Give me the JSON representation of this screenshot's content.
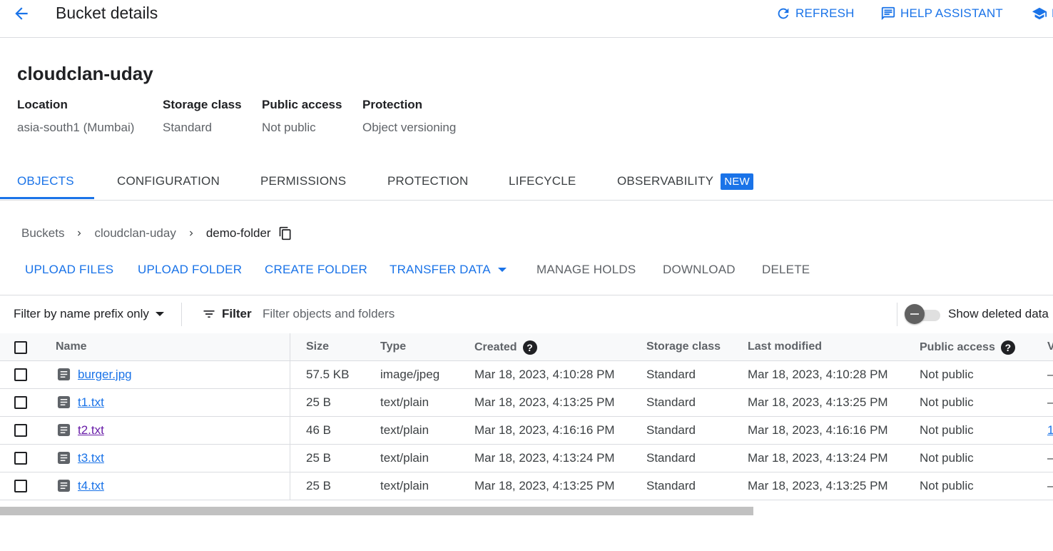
{
  "header": {
    "title": "Bucket details",
    "refresh_label": "REFRESH",
    "help_assistant_label": "HELP ASSISTANT",
    "learn_label": "L"
  },
  "bucket": {
    "name": "cloudclan-uday",
    "info": [
      {
        "label": "Location",
        "value": "asia-south1 (Mumbai)"
      },
      {
        "label": "Storage class",
        "value": "Standard"
      },
      {
        "label": "Public access",
        "value": "Not public"
      },
      {
        "label": "Protection",
        "value": "Object versioning"
      }
    ]
  },
  "tabs": [
    {
      "label": "OBJECTS",
      "active": true
    },
    {
      "label": "CONFIGURATION"
    },
    {
      "label": "PERMISSIONS"
    },
    {
      "label": "PROTECTION"
    },
    {
      "label": "LIFECYCLE"
    },
    {
      "label": "OBSERVABILITY",
      "badge": "NEW"
    }
  ],
  "breadcrumb": [
    "Buckets",
    "cloudclan-uday",
    "demo-folder"
  ],
  "actions": {
    "upload_files": "UPLOAD FILES",
    "upload_folder": "UPLOAD FOLDER",
    "create_folder": "CREATE FOLDER",
    "transfer_data": "TRANSFER DATA",
    "manage_holds": "MANAGE HOLDS",
    "download": "DOWNLOAD",
    "delete": "DELETE"
  },
  "filter": {
    "prefix_label": "Filter by name prefix only",
    "filter_label": "Filter",
    "placeholder": "Filter objects and folders",
    "show_deleted_label": "Show deleted data"
  },
  "table": {
    "columns": {
      "name": "Name",
      "size": "Size",
      "type": "Type",
      "created": "Created",
      "storage_class": "Storage class",
      "last_modified": "Last modified",
      "public_access": "Public access",
      "version": "V"
    },
    "rows": [
      {
        "name": "burger.jpg",
        "size": "57.5 KB",
        "type": "image/jpeg",
        "created": "Mar 18, 2023, 4:10:28 PM",
        "storage_class": "Standard",
        "last_modified": "Mar 18, 2023, 4:10:28 PM",
        "public_access": "Not public",
        "version": "–"
      },
      {
        "name": "t1.txt",
        "size": "25 B",
        "type": "text/plain",
        "created": "Mar 18, 2023, 4:13:25 PM",
        "storage_class": "Standard",
        "last_modified": "Mar 18, 2023, 4:13:25 PM",
        "public_access": "Not public",
        "version": "–"
      },
      {
        "name": "t2.txt",
        "size": "46 B",
        "type": "text/plain",
        "created": "Mar 18, 2023, 4:16:16 PM",
        "storage_class": "Standard",
        "last_modified": "Mar 18, 2023, 4:16:16 PM",
        "public_access": "Not public",
        "version": "1"
      },
      {
        "name": "t3.txt",
        "size": "25 B",
        "type": "text/plain",
        "created": "Mar 18, 2023, 4:13:24 PM",
        "storage_class": "Standard",
        "last_modified": "Mar 18, 2023, 4:13:24 PM",
        "public_access": "Not public",
        "version": "–"
      },
      {
        "name": "t4.txt",
        "size": "25 B",
        "type": "text/plain",
        "created": "Mar 18, 2023, 4:13:25 PM",
        "storage_class": "Standard",
        "last_modified": "Mar 18, 2023, 4:13:25 PM",
        "public_access": "Not public",
        "version": "–"
      }
    ]
  },
  "colors": {
    "accent": "#1a73e8",
    "visited_link": "#681da8",
    "text": "#202124",
    "muted": "#5f6368",
    "divider": "#dadce0"
  },
  "icons": [
    "back-arrow-icon",
    "refresh-icon",
    "help-assistant-icon",
    "learn-icon",
    "chevron-right-icon",
    "copy-icon",
    "dropdown-arrow-icon",
    "filter-icon",
    "help-icon",
    "file-icon"
  ]
}
